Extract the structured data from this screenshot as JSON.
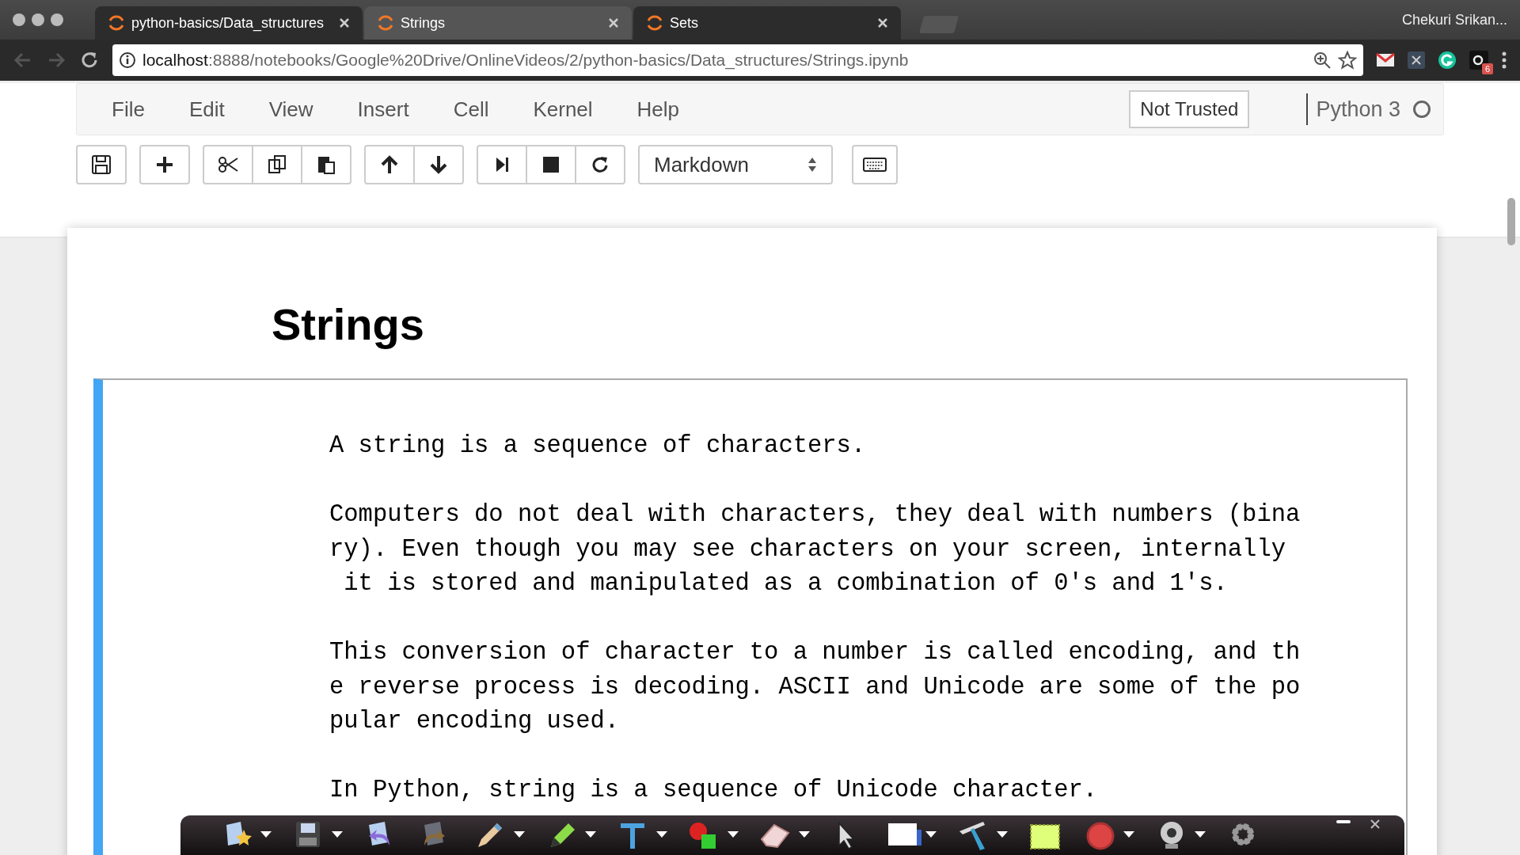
{
  "browser": {
    "tabs": [
      {
        "label": "python-basics/Data_structures",
        "selected": false
      },
      {
        "label": "Strings",
        "selected": true
      },
      {
        "label": "Sets",
        "selected": false
      }
    ],
    "profile": "Chekuri Srikan...",
    "url_host": "localhost",
    "url_rest": ":8888/notebooks/Google%20Drive/OnlineVideos/2/python-basics/Data_structures/Strings.ipynb",
    "extension_badge": "6"
  },
  "menu": [
    "File",
    "Edit",
    "View",
    "Insert",
    "Cell",
    "Kernel",
    "Help"
  ],
  "trust": "Not Trusted",
  "kernel": {
    "name": "Python 3",
    "busy": false
  },
  "cell_type": "Markdown",
  "notebook": {
    "heading": "Strings",
    "cell": {
      "selected": true,
      "paragraphs": [
        [
          "A string is a sequence of characters."
        ],
        [
          "Computers do not deal with characters, they deal with numbers (bina",
          "ry). Even though you may see characters on your screen, internally",
          " it is stored and manipulated as a combination of 0's and 1's."
        ],
        [
          "This conversion of character to a number is called encoding, and th",
          "e reverse process is decoding. ASCII and Unicode are some of the po",
          "pular encoding used."
        ],
        [
          "In Python, string is a sequence of Unicode character."
        ]
      ]
    }
  }
}
